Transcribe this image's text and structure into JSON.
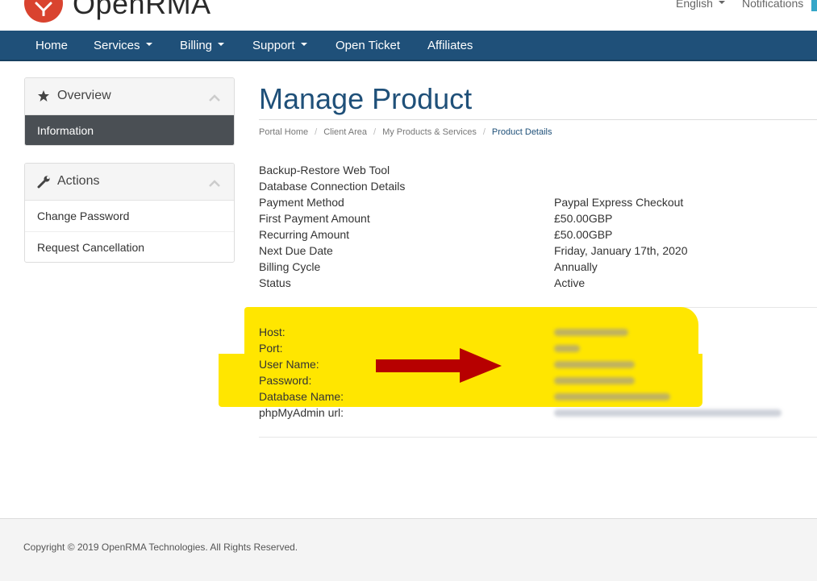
{
  "header": {
    "logo": "OpenRMA",
    "language": "English",
    "notifications": "Notifications"
  },
  "nav": {
    "items": [
      "Home",
      "Services",
      "Billing",
      "Support",
      "Open Ticket",
      "Affiliates"
    ]
  },
  "sidebar": {
    "overview": {
      "title": "Overview",
      "items": [
        "Information"
      ]
    },
    "actions": {
      "title": "Actions",
      "items": [
        "Change Password",
        "Request Cancellation"
      ]
    }
  },
  "main": {
    "title": "Manage Product",
    "breadcrumb": [
      "Portal Home",
      "Client Area",
      "My Products & Services",
      "Product Details"
    ],
    "links": [
      "Backup-Restore Web Tool",
      "Database Connection Details"
    ],
    "details": [
      {
        "label": "Payment Method",
        "value": "Paypal Express Checkout"
      },
      {
        "label": "First Payment Amount",
        "value": "£50.00GBP"
      },
      {
        "label": "Recurring Amount",
        "value": "£50.00GBP"
      },
      {
        "label": "Next Due Date",
        "value": "Friday, January 17th, 2020"
      },
      {
        "label": "Billing Cycle",
        "value": "Annually"
      },
      {
        "label": "Status",
        "value": "Active"
      }
    ],
    "db": {
      "labels": [
        "Host:",
        "Port:",
        "User Name:",
        "Password:",
        "Database Name:",
        "phpMyAdmin url:"
      ]
    }
  },
  "footer": {
    "copyright": "Copyright © 2019 OpenRMA Technologies. All Rights Reserved."
  },
  "colors": {
    "nav": "#1f5079",
    "title": "#1f5079",
    "highlight": "#ffe600",
    "arrow": "#b70000",
    "logo": "#d9432f"
  }
}
